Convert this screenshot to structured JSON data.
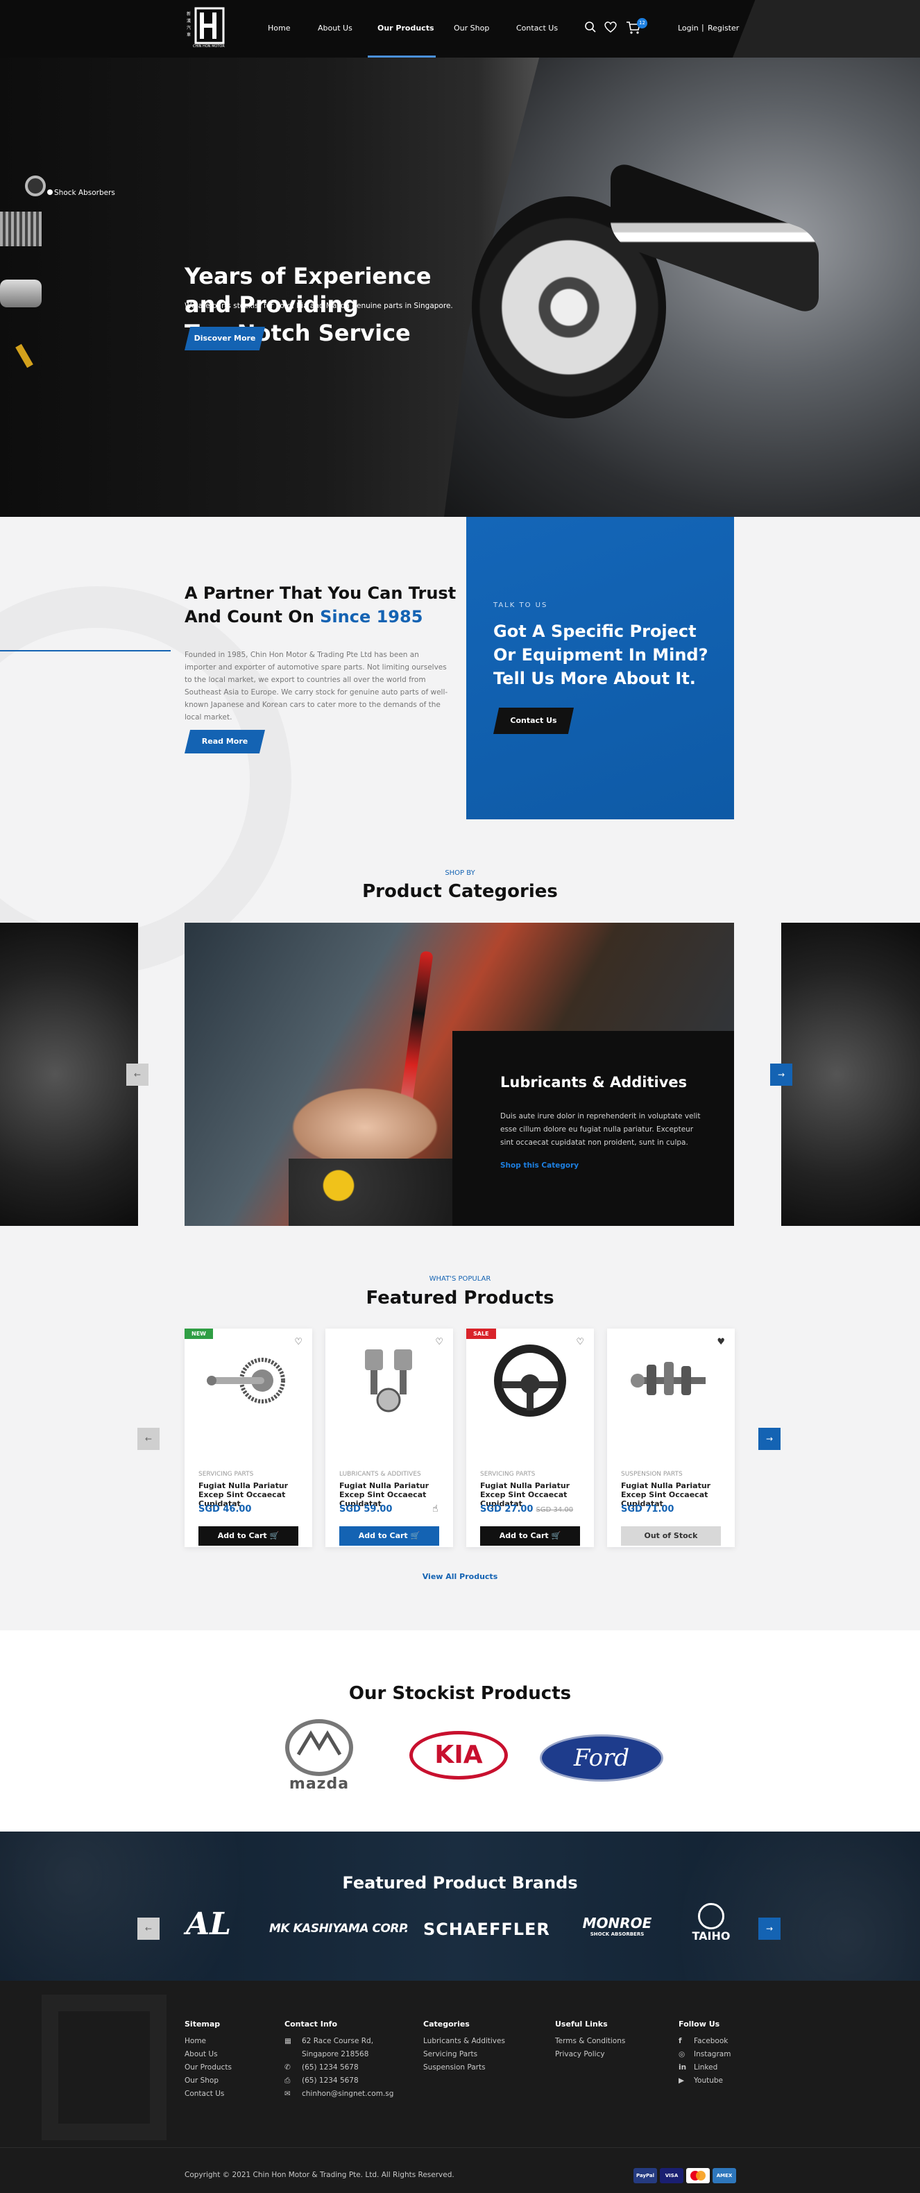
{
  "header": {
    "logo_text": "CHIN HON MOTOR",
    "nav": [
      "Home",
      "About Us",
      "Our Products",
      "Our Shop",
      "Contact Us"
    ],
    "active_nav": "Our Products",
    "cart_count": "12",
    "login": "Login",
    "separator": "|",
    "register": "Register"
  },
  "hero": {
    "side_label": "Shock Absorbers",
    "title_line1": "Years of Experience",
    "title_line2": "and Providing",
    "title_line3": "Top-Notch Service",
    "subtitle": "We are parts stockist for Ford, Kia and Mazda genuine parts in Singapore.",
    "cta": "Discover More"
  },
  "partner": {
    "title_line1": "A Partner That You Can Trust",
    "title_line2": "And Count On ",
    "title_highlight": "Since 1985",
    "body": "Founded in 1985, Chin Hon Motor & Trading Pte Ltd has been an importer and exporter of automotive spare parts. Not limiting ourselves to the local market, we export to countries all over the world from Southeast Asia to Europe. We carry stock for genuine auto parts of well-known Japanese and Korean cars to cater more to the demands of the local market.",
    "cta": "Read More"
  },
  "talk": {
    "eyebrow": "TALK TO US",
    "title_line1": "Got A Specific Project",
    "title_line2": "Or Equipment In Mind?",
    "title_line3": "Tell Us More About It.",
    "cta": "Contact Us"
  },
  "categories": {
    "eyebrow": "SHOP BY",
    "title": "Product Categories",
    "panel_title": "Lubricants & Additives",
    "panel_body": "Duis aute irure dolor in reprehenderit in voluptate velit esse cillum dolore eu fugiat nulla pariatur. Excepteur sint occaecat cupidatat non proident, sunt in culpa.",
    "panel_link": "Shop this Category"
  },
  "featured": {
    "eyebrow": "WHAT'S POPULAR",
    "title": "Featured Products",
    "view_all": "View All Products",
    "products": [
      {
        "badge": "NEW",
        "category": "SERVICING PARTS",
        "name": "Fugiat Nulla Pariatur Excep Sint Occaecat Cupidatat",
        "price": "SGD 46.00",
        "old_price": "",
        "button": "Add to Cart"
      },
      {
        "badge": "",
        "category": "LUBRICANTS & ADDITIVES",
        "name": "Fugiat Nulla Pariatur Excep Sint Occaecat Cupidatat",
        "price": "SGD 59.00",
        "old_price": "",
        "button": "Add to Cart"
      },
      {
        "badge": "SALE",
        "category": "SERVICING PARTS",
        "name": "Fugiat Nulla Pariatur Excep Sint Occaecat Cupidatat",
        "price": "SGD 27.00",
        "old_price": "SGD 34.00",
        "button": "Add to Cart"
      },
      {
        "badge": "",
        "category": "SUSPENSION PARTS",
        "name": "Fugiat Nulla Pariatur Excep Sint Occaecat Cupidatat",
        "price": "SGD 71.00",
        "old_price": "",
        "button": "Out of Stock"
      }
    ]
  },
  "stockist": {
    "title": "Our Stockist Products",
    "brands": [
      "mazda",
      "KIA",
      "Ford"
    ]
  },
  "brands": {
    "title": "Featured Product Brands",
    "items": [
      "AL",
      "MK KASHIYAMA CORP.",
      "SCHAEFFLER",
      "MONROE",
      "SHOCK ABSORBERS",
      "TAIHO"
    ]
  },
  "footer": {
    "sitemap_title": "Sitemap",
    "sitemap": [
      "Home",
      "About Us",
      "Our Products",
      "Our Shop",
      "Contact Us"
    ],
    "contact_title": "Contact Info",
    "address1": "62 Race Course Rd,",
    "address2": "Singapore 218568",
    "phone": "(65) 1234 5678",
    "fax": "(65) 1234 5678",
    "email": "chinhon@singnet.com.sg",
    "categories_title": "Categories",
    "categories": [
      "Lubricants & Additives",
      "Servicing Parts",
      "Suspension Parts"
    ],
    "useful_title": "Useful Links",
    "useful": [
      "Terms & Conditions",
      "Privacy Policy"
    ],
    "follow_title": "Follow Us",
    "social": [
      "Facebook",
      "Instagram",
      "Linked",
      "Youtube"
    ],
    "copyright": "Copyright © 2021 Chin Hon Motor & Trading Pte. Ltd. All Rights Reserved.",
    "payments": [
      "PayPal",
      "VISA",
      "MC",
      "AMEX"
    ]
  },
  "colors": {
    "accent": "#1463b3",
    "dark": "#0c0c0c",
    "sale": "#d9232a",
    "new": "#2f9e44"
  }
}
